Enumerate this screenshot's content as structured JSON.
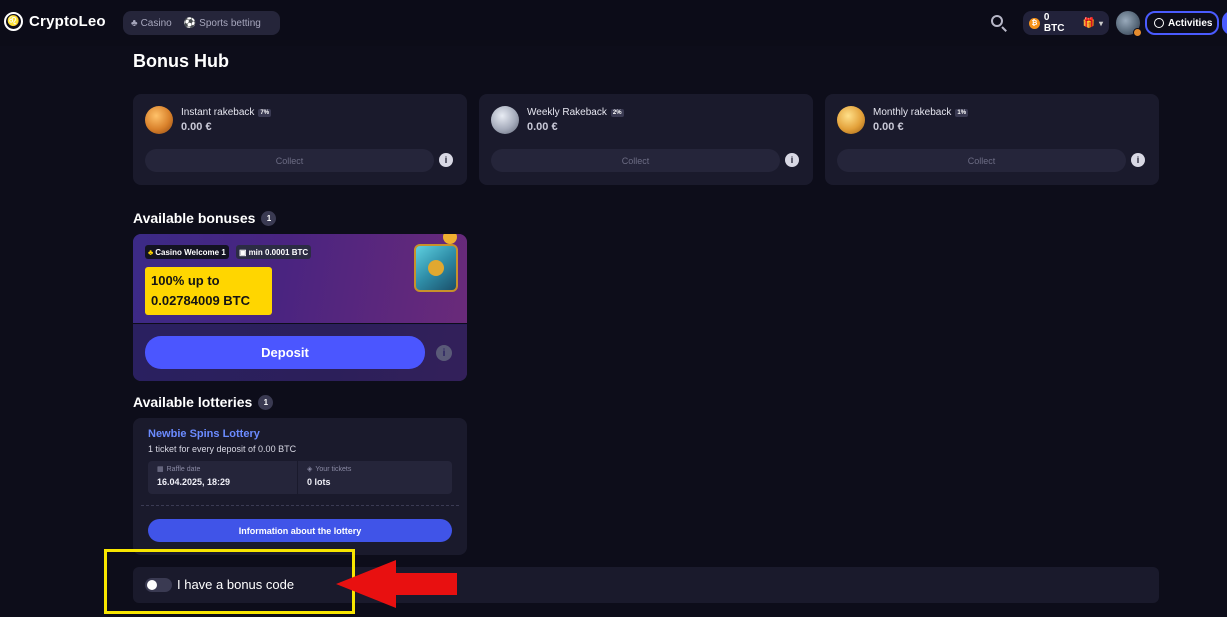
{
  "header": {
    "logo_text": "CryptoLeo",
    "nav": [
      {
        "label": "Casino",
        "icon": "casino-icon"
      },
      {
        "label": "Sports betting",
        "icon": "ball-icon"
      }
    ],
    "balance": "0 BTC",
    "activities_label": "Activities"
  },
  "page": {
    "title": "Bonus Hub"
  },
  "rakebacks": [
    {
      "title": "Instant rakeback",
      "badge": "7%",
      "amount": "0.00 €",
      "button": "Collect",
      "coin": "bronze"
    },
    {
      "title": "Weekly Rakeback",
      "badge": "2%",
      "amount": "0.00 €",
      "button": "Collect",
      "coin": "silver"
    },
    {
      "title": "Monthly rakeback",
      "badge": "1%",
      "amount": "0.00 €",
      "button": "Collect",
      "coin": "gold"
    }
  ],
  "bonuses": {
    "title": "Available bonuses",
    "count": "1",
    "card": {
      "tag": "Casino Welcome 1",
      "min": "min 0.0001 BTC",
      "offer_line1": "100% up to",
      "offer_line2": "0.02784009 BTC",
      "button": "Deposit"
    }
  },
  "lotteries": {
    "title": "Available lotteries",
    "count": "1",
    "card": {
      "name": "Newbie Spins Lottery",
      "desc": "1 ticket for every deposit of 0.00 BTC",
      "raffle_label": "Raffle date",
      "raffle_value": "16.04.2025, 18:29",
      "tickets_label": "Your tickets",
      "tickets_value": "0 lots",
      "button": "Information about the lottery"
    }
  },
  "bonus_code": {
    "label": "I have a bonus code",
    "enabled": false
  },
  "colors": {
    "accent": "#4b56ff",
    "background": "#0d0d1a",
    "card": "#1a1a2c",
    "highlight": "#f7e500",
    "arrow": "#e81010",
    "offer": "#ffd600"
  }
}
